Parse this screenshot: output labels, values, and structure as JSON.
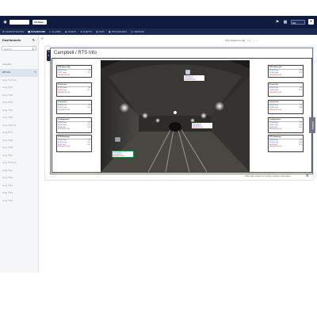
{
  "topbar": {
    "logo": "◉",
    "site_select": "",
    "org_select": "All Sites",
    "icons": [
      "bell-icon",
      "grid-icon",
      "user-icon"
    ],
    "user_select": "EN",
    "avatar": "●"
  },
  "nav": [
    {
      "label": "ADMINISTRATION",
      "icon": "⚙",
      "active": false
    },
    {
      "label": "DASHBOARD",
      "icon": "▦",
      "active": true
    },
    {
      "label": "ALARMS",
      "icon": "⚠",
      "active": false
    },
    {
      "label": "ASSETS",
      "icon": "◆",
      "active": false
    },
    {
      "label": "EVENTS",
      "icon": "★",
      "active": false
    },
    {
      "label": "DATA",
      "icon": "▤",
      "active": false
    },
    {
      "label": "PROCEDURES",
      "icon": "▣",
      "active": false
    },
    {
      "label": "SENSORS",
      "icon": "◎",
      "active": false
    }
  ],
  "sidebar": {
    "title": "Dashboards",
    "search_placeholder": "Search",
    "group_label": "Campbell",
    "items": [
      {
        "label": "RTS Info",
        "active": true
      },
      {
        "label": "Array TS-03 (C)",
        "active": false
      },
      {
        "label": "Array TS01",
        "active": false
      },
      {
        "label": "Array TS02",
        "active": false
      },
      {
        "label": "Array TS03",
        "active": false
      },
      {
        "label": "Array TS04",
        "active": false
      },
      {
        "label": "Array TS05",
        "active": false
      },
      {
        "label": "Array TS06 (S)",
        "active": false
      },
      {
        "label": "Array TS07",
        "active": false
      },
      {
        "label": "Array TS08",
        "active": false
      },
      {
        "label": "Array TS09",
        "active": false
      },
      {
        "label": "Array TS10",
        "active": false
      },
      {
        "label": "Array TS-10 (C)",
        "active": false
      },
      {
        "label": "Array TS11",
        "active": false
      },
      {
        "label": "Array TS12",
        "active": false
      },
      {
        "label": "Array TS13",
        "active": false
      },
      {
        "label": "Array TS14",
        "active": false
      },
      {
        "label": "Array TS15",
        "active": false
      }
    ]
  },
  "filter_text": "Filter variables by flag",
  "pager": "1 / 1",
  "widget": {
    "title": "Campbell / RTS Info"
  },
  "left_cards": [
    {
      "title": "RTS Status (N)",
      "rows": [
        [
          "RTS01 Prism",
          "OK"
        ],
        [
          "RTS01 Temp",
          "21.3"
        ]
      ],
      "ts": "2023-08-31 12:00"
    },
    {
      "title": "Prism Info",
      "rows": [
        [
          "RTS02 Prism",
          "OK"
        ],
        [
          "RTS02 Temp",
          "21.1"
        ]
      ],
      "ts": "2023-08-31 12:00"
    },
    {
      "title": "Comm Info",
      "rows": [
        [
          "RTS03 Prism",
          "OK"
        ],
        [
          "RTS03 Temp",
          "20.9"
        ]
      ],
      "ts": "2023-08-31 12:00"
    },
    {
      "title": "Configuration",
      "rows": [
        [
          "RTS04 Prism",
          "OK"
        ],
        [
          "RTS04 Temp",
          "21.0"
        ],
        [
          "RTS04 Volt",
          "12.4"
        ]
      ],
      "ts": "2023-08-31 12:00"
    },
    {
      "title": "RTS Readings",
      "rows": [
        [
          "RTS05 Prism",
          "OK"
        ],
        [
          "RTS05 Temp",
          "20.7"
        ],
        [
          "RTS05 Volt",
          "12.5"
        ]
      ],
      "ts": "2023-08-31 12:00"
    }
  ],
  "right_cards": [
    {
      "title": "RTS Status (S)",
      "rows": [
        [
          "RTS06 Prism",
          "OK"
        ],
        [
          "RTS06 Temp",
          "21.4"
        ]
      ],
      "ts": "2023-08-31 12:00"
    },
    {
      "title": "Prism Info",
      "rows": [
        [
          "RTS07 Prism",
          "OK"
        ],
        [
          "RTS07 Temp",
          "21.2"
        ]
      ],
      "ts": "2023-08-31 12:00"
    },
    {
      "title": "Comm Info",
      "rows": [
        [
          "RTS08 Prism",
          "OK"
        ],
        [
          "RTS08 Temp",
          "20.8"
        ]
      ],
      "ts": "2023-08-31 12:00"
    },
    {
      "title": "Configuration",
      "rows": [
        [
          "RTS09 Prism",
          "OK"
        ],
        [
          "RTS09 Temp",
          "21.0"
        ],
        [
          "RTS09 Volt",
          "12.3"
        ]
      ],
      "ts": "2023-08-31 12:00"
    },
    {
      "title": "RTS Readings",
      "rows": [
        [
          "RTS10 Prism",
          "OK"
        ],
        [
          "RTS10 Temp",
          "20.6"
        ],
        [
          "RTS10 Volt",
          "12.5"
        ]
      ],
      "ts": "2023-08-31 12:00"
    }
  ],
  "callouts": [
    {
      "rows": [
        "RTS Prism 01",
        "RTS Temp 01"
      ],
      "val": "2023-08-31 12:00"
    },
    {
      "rows": [
        "RTS Prism 02",
        "RTS Temp 02"
      ],
      "val": "2023-08-31 12:00"
    },
    {
      "rows": [
        "RTS Prism 03",
        "RTS Temp 03"
      ],
      "val": "2023-08-31 12:00"
    }
  ],
  "right_tab": "Variables",
  "footer_note": "Click rolling button on setting a global customizing",
  "colors": {
    "topbar": "#0f1c3f",
    "navbar": "#1a2a52",
    "link": "#2050c0",
    "alert": "#cc0000"
  }
}
